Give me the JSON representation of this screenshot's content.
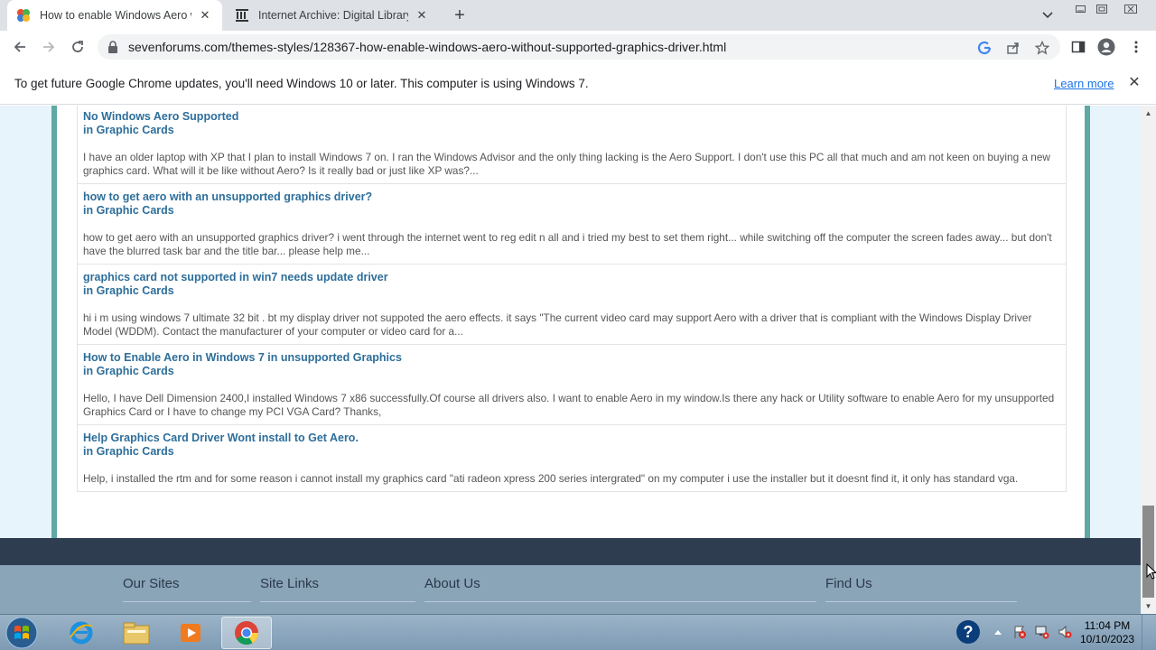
{
  "browser": {
    "tabs": [
      {
        "title": "How to enable Windows Aero wi",
        "icon": "sevenforums-favicon",
        "active": true
      },
      {
        "title": "Internet Archive: Digital Library o",
        "icon": "internet-archive-favicon",
        "active": false
      }
    ],
    "url": "sevenforums.com/themes-styles/128367-how-enable-windows-aero-without-supported-graphics-driver.html"
  },
  "infobar": {
    "message": "To get future Google Chrome updates, you'll need Windows 10 or later. This computer is using Windows 7.",
    "link": "Learn more"
  },
  "results": [
    {
      "title": "No Windows Aero Supported",
      "forum": "in Graphic Cards",
      "snippet": "I have an older laptop with XP that I plan to install Windows 7 on. I ran the Windows Advisor and the only thing lacking is the Aero Support. I don't use this PC all that much and am not keen on buying a new graphics card. What will it be like without Aero? Is it really bad or just like XP was?..."
    },
    {
      "title": "how to get aero with an unsupported graphics driver?",
      "forum": "in Graphic Cards",
      "snippet": "how to get aero with an unsupported graphics driver? i went through the internet went to reg edit n all and i tried my best to set them right... while switching off the computer the screen fades away... but don't have the blurred task bar and the title bar... please help me..."
    },
    {
      "title": "graphics card not supported in win7 needs update driver",
      "forum": "in Graphic Cards",
      "snippet": "hi i m using windows 7 ultimate 32 bit . bt my display driver not suppoted the aero effects. it says \"The current video card may support Aero with a driver that is compliant with the Windows Display Driver Model (WDDM). Contact the manufacturer of your computer or video card for a..."
    },
    {
      "title": "How to Enable Aero in Windows 7 in unsupported Graphics",
      "forum": "in Graphic Cards",
      "snippet": "Hello, I have Dell Dimension 2400,I installed Windows 7 x86 successfully.Of course all drivers also. I want to enable Aero in my window.Is there any hack or Utility software to enable Aero for my unsupported Graphics Card or I have to change my PCI VGA Card? Thanks,"
    },
    {
      "title": "Help Graphics Card Driver Wont install to Get Aero.",
      "forum": "in Graphic Cards",
      "snippet": "Help, i installed the rtm and for some reason i cannot install my graphics card \"ati radeon xpress 200 series intergrated\" on my computer i use the installer but it doesnt find it, it only has standard vga."
    }
  ],
  "footer": {
    "columns": [
      "Our Sites",
      "Site Links",
      "About Us",
      "Find Us"
    ]
  },
  "taskbar": {
    "apps": [
      "internet-explorer",
      "windows-explorer",
      "media-player",
      "google-chrome"
    ],
    "time": "11:04 PM",
    "date": "10/10/2023"
  },
  "colors": {
    "link": "#2d6e9a",
    "panel_border": "#5fa8a3",
    "footer_band": "#2e3e50",
    "footer": "#8aa4b8"
  }
}
